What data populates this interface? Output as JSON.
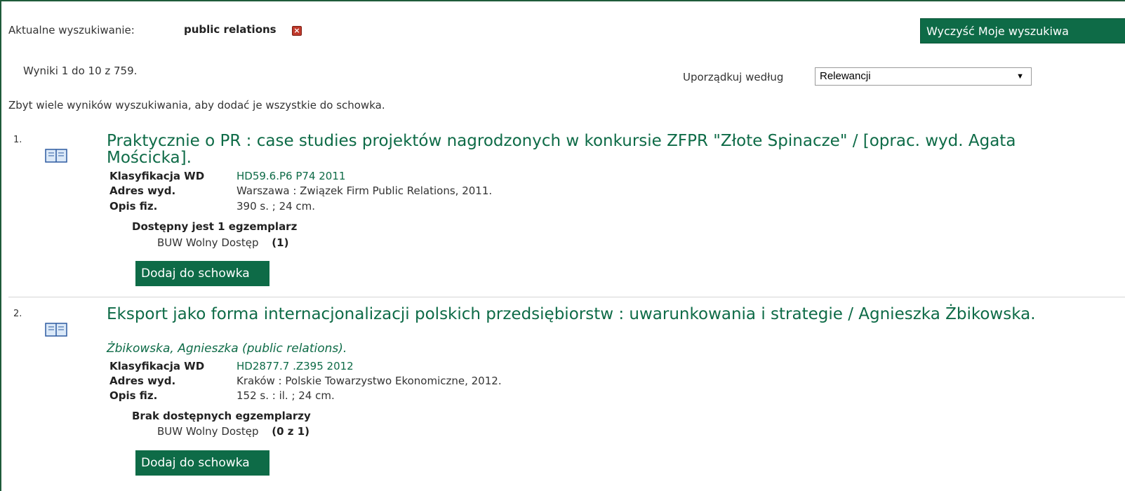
{
  "search": {
    "label": "Aktualne wyszukiwanie:",
    "term": "public relations",
    "remove_icon": "remove-x-icon",
    "clear_button": "Wyczyść Moje wyszukiwa"
  },
  "results": {
    "count_text": "Wyniki 1 do 10 z 759.",
    "too_many_text": "Zbyt wiele wyników wyszukiwania, aby dodać je wszystkie do schowka."
  },
  "sort": {
    "label": "Uporządkuj według",
    "selected": "Relewancji"
  },
  "records": [
    {
      "number": "1.",
      "icon": "book-icon",
      "title": "Praktycznie o PR : case studies projektów nagrodzonych w konkursie ZFPR \"Złote Spinacze\" / [oprac. wyd. Agata Mościcka].",
      "fields": [
        {
          "label": "Klasyfikacja WD",
          "value": "HD59.6.P6 P74 2011"
        },
        {
          "label": "Adres wyd.",
          "value": "Warszawa : Związek Firm Public Relations, 2011."
        },
        {
          "label": "Opis fiz.",
          "value": "390 s. ; 24 cm."
        }
      ],
      "availability": {
        "title": "Dostępny jest 1 egzemplarz",
        "location": "BUW Wolny Dostęp",
        "count": "(1)"
      },
      "add_button": "Dodaj do schowka"
    },
    {
      "number": "2.",
      "icon": "book-icon",
      "title": "Eksport jako forma internacjonalizacji polskich przedsiębiorstw : uwarunkowania i strategie / Agnieszka Żbikowska.",
      "author": "Żbikowska, Agnieszka (public relations).",
      "fields": [
        {
          "label": "Klasyfikacja WD",
          "value": "HD2877.7 .Z395 2012"
        },
        {
          "label": "Adres wyd.",
          "value": "Kraków : Polskie Towarzystwo Ekonomiczne, 2012."
        },
        {
          "label": "Opis fiz.",
          "value": "152 s. : il. ; 24 cm."
        }
      ],
      "availability": {
        "title": "Brak dostępnych egzemplarzy",
        "location": "BUW Wolny Dostęp",
        "count": "(0 z 1)"
      },
      "add_button": "Dodaj do schowka"
    }
  ],
  "colors": {
    "accent": "#0e6b47",
    "remove_icon": "#c0392b"
  }
}
